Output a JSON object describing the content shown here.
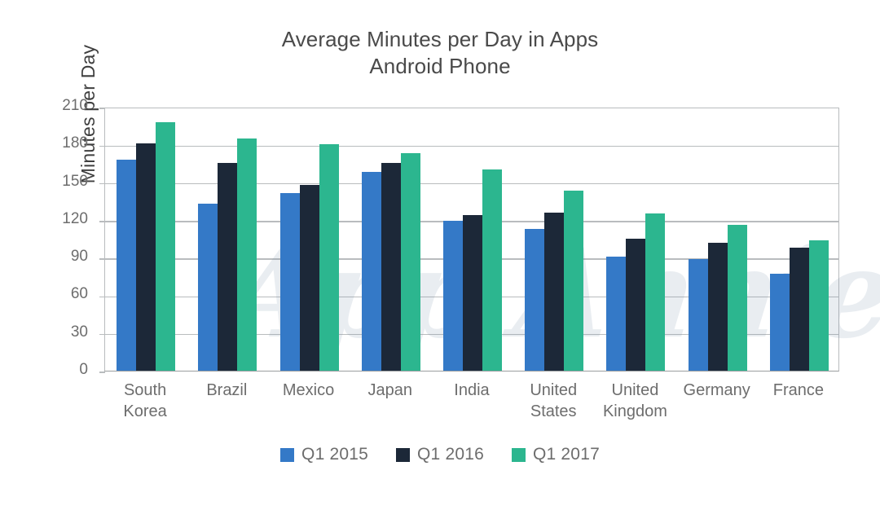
{
  "chart_data": {
    "type": "bar",
    "title": "Average Minutes per Day in Apps",
    "subtitle": "Android Phone",
    "xlabel": "",
    "ylabel": "Minutes per Day",
    "ylim": [
      0,
      210
    ],
    "ytick_step": 30,
    "yticks": [
      210,
      180,
      150,
      120,
      90,
      60,
      30,
      0
    ],
    "grid": true,
    "legend_position": "bottom",
    "categories": [
      "South Korea",
      "Brazil",
      "Mexico",
      "Japan",
      "India",
      "United States",
      "United Kingdom",
      "Germany",
      "France"
    ],
    "category_lines": [
      [
        "South",
        "Korea"
      ],
      [
        "Brazil",
        ""
      ],
      [
        "Mexico",
        ""
      ],
      [
        "Japan",
        ""
      ],
      [
        "India",
        ""
      ],
      [
        "United",
        "States"
      ],
      [
        "United",
        "Kingdom"
      ],
      [
        "Germany",
        ""
      ],
      [
        "France",
        ""
      ]
    ],
    "series": [
      {
        "name": "Q1 2015",
        "color": "#3479c7",
        "values": [
          168,
          133,
          141,
          158,
          119,
          113,
          91,
          89,
          77
        ]
      },
      {
        "name": "Q1 2016",
        "color": "#1c2838",
        "values": [
          181,
          165,
          148,
          165,
          124,
          126,
          105,
          102,
          98
        ]
      },
      {
        "name": "Q1 2017",
        "color": "#2cb68f",
        "values": [
          198,
          185,
          180,
          173,
          160,
          143,
          125,
          116,
          104
        ]
      }
    ],
    "watermark": "App Annie"
  },
  "axis": {
    "grid_color": "#b9bcbe",
    "tick_label_color": "#6d6d6d",
    "title_color": "#4a4a4a"
  }
}
